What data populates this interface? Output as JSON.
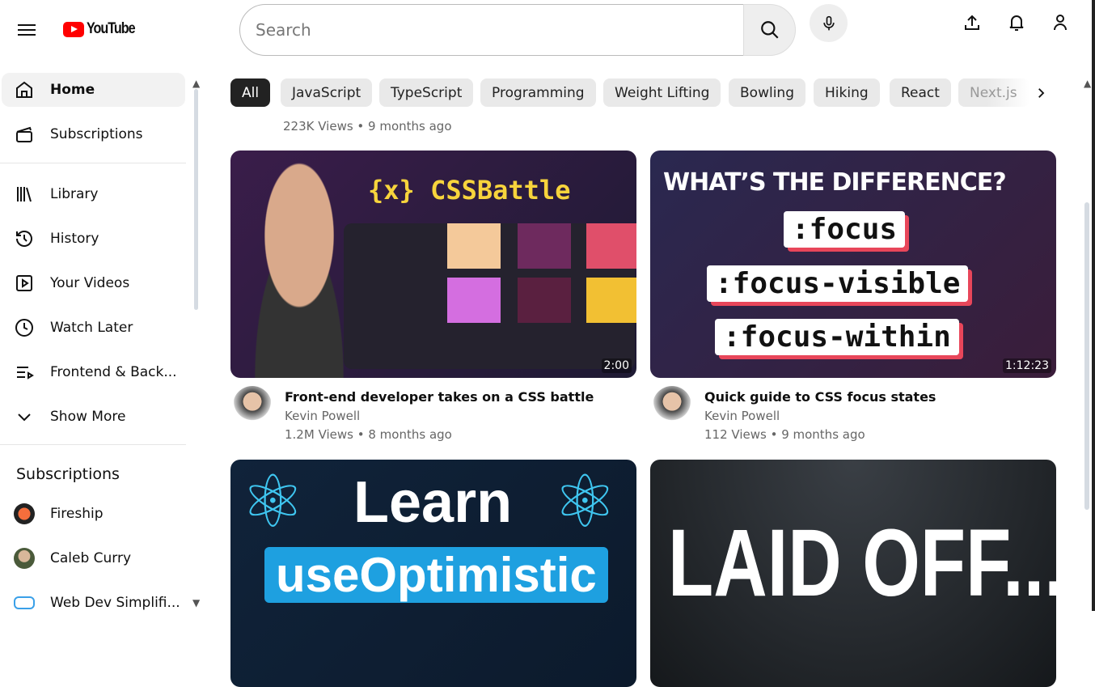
{
  "header": {
    "logo": "YouTube",
    "search_placeholder": "Search"
  },
  "sidebar": {
    "items": [
      {
        "label": "Home"
      },
      {
        "label": "Subscriptions"
      },
      {
        "label": "Library"
      },
      {
        "label": "History"
      },
      {
        "label": "Your Videos"
      },
      {
        "label": "Watch Later"
      },
      {
        "label": "Frontend & Back..."
      },
      {
        "label": "Show More"
      }
    ],
    "subscriptions_title": "Subscriptions",
    "subscriptions": [
      {
        "label": "Fireship"
      },
      {
        "label": "Caleb Curry"
      },
      {
        "label": "Web Dev Simplifi..."
      }
    ]
  },
  "chips": [
    "All",
    "JavaScript",
    "TypeScript",
    "Programming",
    "Weight Lifting",
    "Bowling",
    "Hiking",
    "React",
    "Next.js"
  ],
  "prev_row_stats": "223K Views • 9 months ago",
  "videos": [
    {
      "title": "Front-end developer takes on a CSS battle",
      "channel": "Kevin Powell",
      "stats": "1.2M Views • 8 months ago",
      "duration": "2:00",
      "thumb_text": [
        "{x} CSSBattle"
      ]
    },
    {
      "title": "Quick guide to CSS focus states",
      "channel": "Kevin Powell",
      "stats": "112 Views • 9 months ago",
      "duration": "1:12:23",
      "thumb_text": [
        "WHAT’S THE DIFFERENCE?",
        ":focus",
        ":focus-visible",
        ":focus-within"
      ]
    },
    {
      "thumb_text": [
        "Learn",
        "useOptimistic"
      ]
    },
    {
      "thumb_text": [
        "LAID OFF..."
      ]
    }
  ]
}
